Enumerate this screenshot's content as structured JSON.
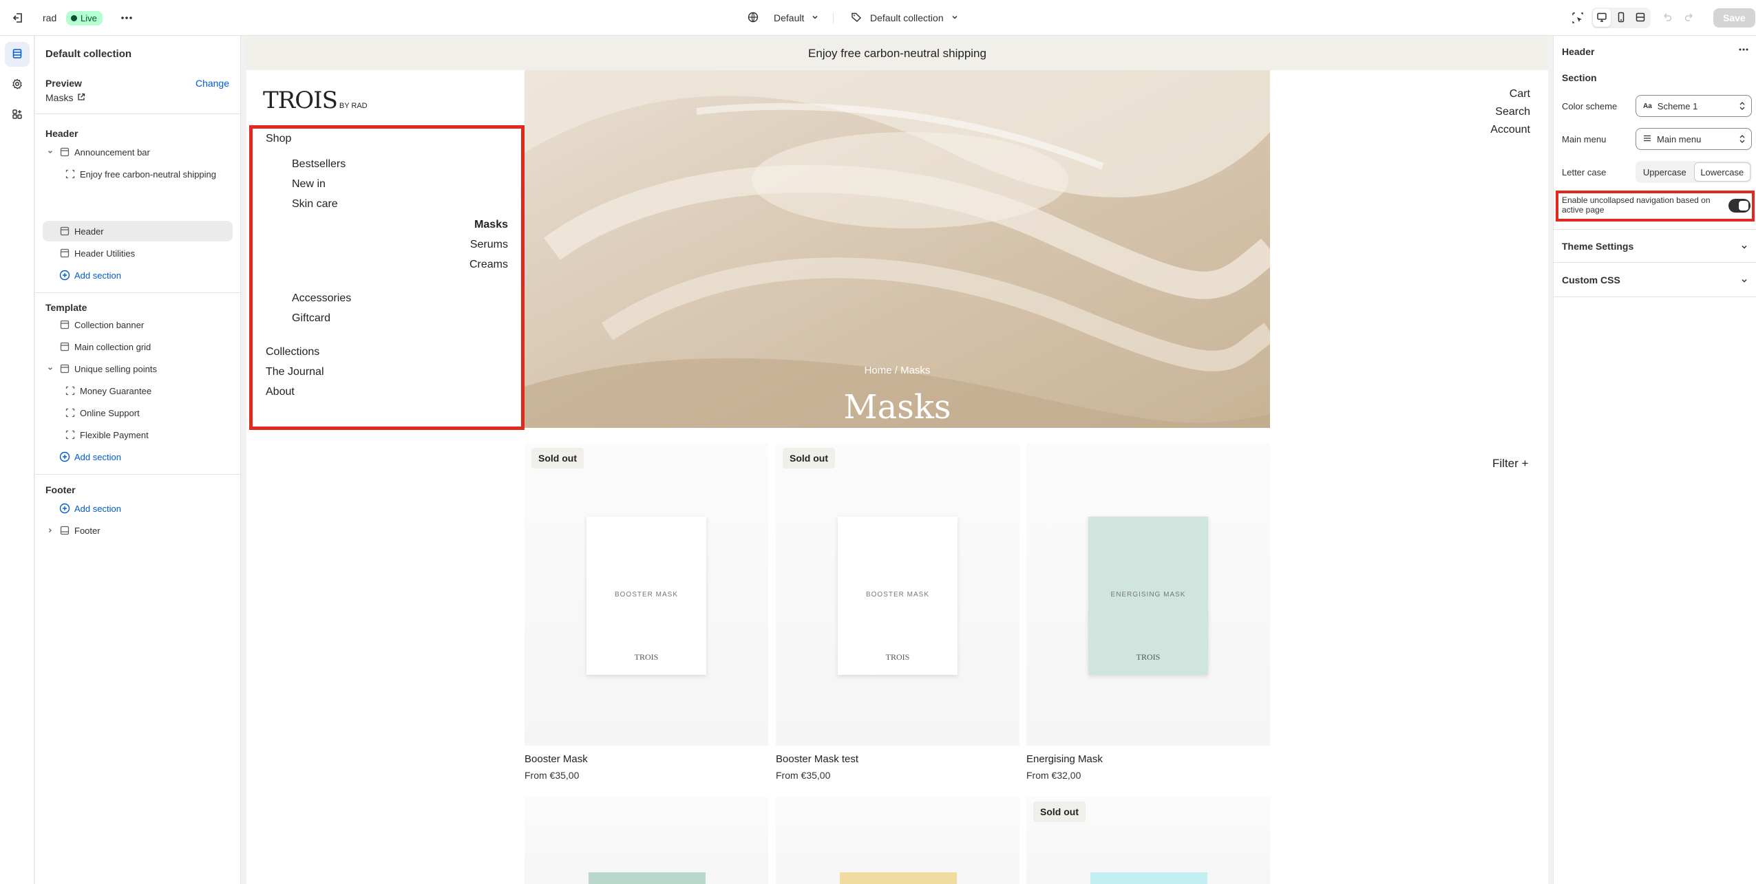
{
  "topbar": {
    "store_name": "rad",
    "status": "Live",
    "theme": "Default",
    "template": "Default collection",
    "save_label": "Save"
  },
  "left_panel": {
    "title": "Default collection",
    "preview_label": "Preview",
    "change_label": "Change",
    "preview_value": "Masks",
    "header_group": {
      "heading": "Header",
      "announcement_bar": "Announcement bar",
      "announcement_text": "Enjoy free carbon-neutral shipping",
      "header": "Header",
      "header_utilities": "Header Utilities",
      "add_section": "Add section"
    },
    "template_group": {
      "heading": "Template",
      "collection_banner": "Collection banner",
      "main_collection_grid": "Main collection grid",
      "unique_selling_points": "Unique selling points",
      "money_guarantee": "Money Guarantee",
      "online_support": "Online Support",
      "flexible_payment": "Flexible Payment",
      "add_section": "Add section"
    },
    "footer_group": {
      "heading": "Footer",
      "add_section": "Add section",
      "footer": "Footer"
    }
  },
  "preview": {
    "announcement": "Enjoy free carbon-neutral shipping",
    "logo": "TROIS",
    "logo_sub": "BY RAD",
    "nav": {
      "shop": "Shop",
      "bestsellers": "Bestsellers",
      "new_in": "New in",
      "skin_care": "Skin care",
      "masks": "Masks",
      "serums": "Serums",
      "creams": "Creams",
      "accessories": "Accessories",
      "giftcard": "Giftcard",
      "collections": "Collections",
      "journal": "The Journal",
      "about": "About"
    },
    "account_nav": {
      "cart": "Cart",
      "search": "Search",
      "account": "Account"
    },
    "breadcrumb": "Home / Masks",
    "hero_title": "Masks",
    "filter": "Filter +",
    "sold_out": "Sold out",
    "products": [
      {
        "name": "Booster Mask",
        "price": "From €35,00",
        "pack_label": "BOOSTER MASK",
        "brand": "TROIS",
        "sold_out": true,
        "color": "#ffffff"
      },
      {
        "name": "Booster Mask test",
        "price": "From €35,00",
        "pack_label": "BOOSTER MASK",
        "brand": "TROIS",
        "sold_out": true,
        "color": "#ffffff"
      },
      {
        "name": "Energising Mask",
        "price": "From €32,00",
        "pack_label": "ENERGISING MASK",
        "brand": "TROIS",
        "sold_out": false,
        "color": "#cfe5dd"
      }
    ]
  },
  "right_panel": {
    "title": "Header",
    "section_label": "Section",
    "color_scheme_label": "Color scheme",
    "color_scheme_value": "Scheme 1",
    "color_scheme_icon_text": "Aa",
    "main_menu_label": "Main menu",
    "main_menu_value": "Main menu",
    "letter_case_label": "Letter case",
    "uppercase": "Uppercase",
    "lowercase": "Lowercase",
    "toggle_label": "Enable uncollapsed navigation based on active page",
    "theme_settings": "Theme Settings",
    "custom_css": "Custom CSS"
  }
}
